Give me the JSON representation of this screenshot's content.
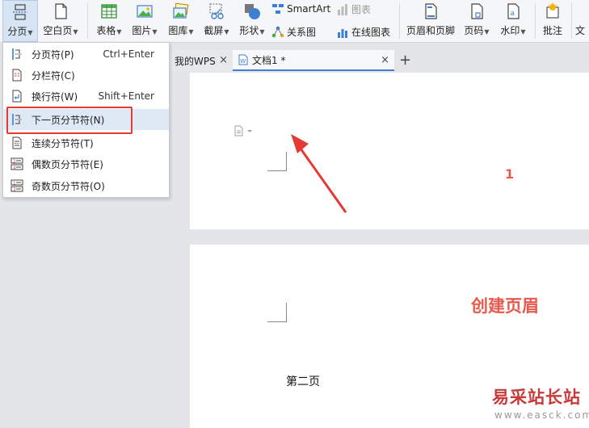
{
  "ribbon": {
    "page_break": "分页",
    "blank_page": "空白页",
    "table": "表格",
    "picture": "图片",
    "gallery": "图库",
    "screenshot": "截屏",
    "shape": "形状",
    "smartart": "SmartArt",
    "chart": "图表",
    "relation": "关系图",
    "online_chart": "在线图表",
    "header_footer": "页眉和页脚",
    "page_number": "页码",
    "watermark": "水印",
    "comment": "批注",
    "text_partial": "文"
  },
  "tabs": {
    "wps": "我的WPS",
    "doc": "文档1 *",
    "close": "×",
    "add": "+"
  },
  "menu": {
    "items": [
      {
        "label": "分页符(P)",
        "shortcut": "Ctrl+Enter"
      },
      {
        "label": "分栏符(C)",
        "shortcut": ""
      },
      {
        "label": "换行符(W)",
        "shortcut": "Shift+Enter"
      },
      {
        "label": "下一页分节符(N)",
        "shortcut": ""
      },
      {
        "label": "连续分节符(T)",
        "shortcut": ""
      },
      {
        "label": "偶数页分节符(E)",
        "shortcut": ""
      },
      {
        "label": "奇数页分节符(O)",
        "shortcut": ""
      }
    ]
  },
  "document": {
    "page1_number": "1",
    "page2_annotation": "创建页眉",
    "page2_text": "第二页"
  },
  "watermark": {
    "title": "易采站长站",
    "url": "www.easck.com"
  },
  "colors": {
    "annotation": "#e8594d",
    "highlight": "#e53935",
    "accent": "#3d7fd4"
  }
}
